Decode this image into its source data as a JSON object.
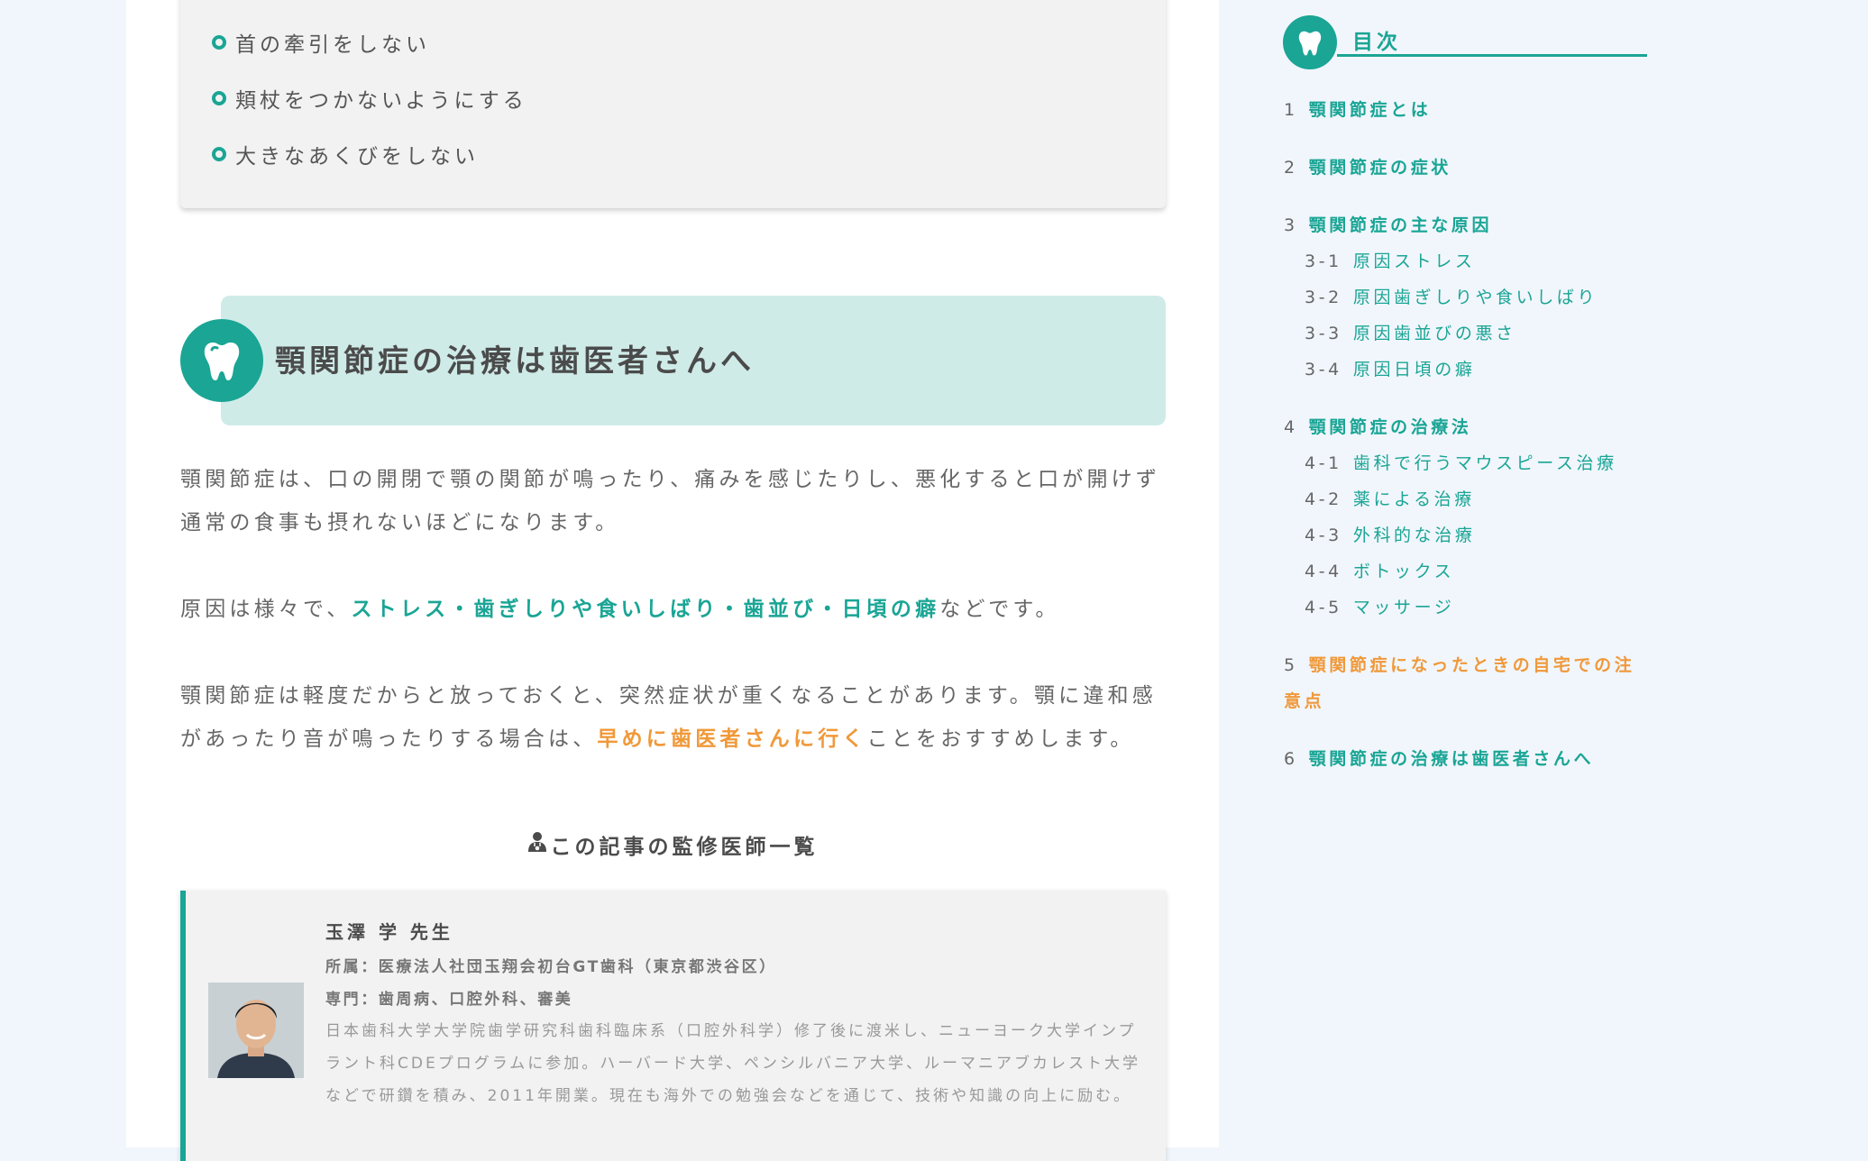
{
  "points": {
    "items": [
      "首の牽引をしない",
      "頬杖をつかないようにする",
      "大きなあくびをしない"
    ]
  },
  "section": {
    "title": "顎関節症の治療は歯医者さんへ",
    "para1": "顎関節症は、口の開閉で顎の関節が鳴ったり、痛みを感じたりし、悪化すると口が開けず通常の食事も摂れないほどになります。",
    "para2_before": "原因は様々で、",
    "para2_highlight": "ストレス・歯ぎしりや食いしばり・歯並び・日頃の癖",
    "para2_after": "などです。",
    "para3_before": "顎関節症は軽度だからと放っておくと、突然症状が重くなることがあります。顎に違和感があったり音が鳴ったりする場合は、",
    "para3_highlight": "早めに歯医者さんに行く",
    "para3_after": "ことをおすすめします。"
  },
  "supervisor": {
    "heading": "この記事の監修医師一覧",
    "name": "玉澤 学 先生",
    "affiliation": "所属：医療法人社団玉翔会初台GT歯科（東京都渋谷区）",
    "specialty": "専門：歯周病、口腔外科、審美",
    "bio": "日本歯科大学大学院歯学研究科歯科臨床系（口腔外科学）修了後に渡米し、ニューヨーク大学インプラント科CDEプログラムに参加。ハーバード大学、ペンシルバニア大学、ルーマニアブカレスト大学などで研鑽を積み、2011年開業。現在も海外での勉強会などを通じて、技術や知識の向上に励む。"
  },
  "toc": {
    "title": "目次",
    "items": [
      {
        "num": "1",
        "label": "顎関節症とは"
      },
      {
        "num": "2",
        "label": "顎関節症の症状"
      },
      {
        "num": "3",
        "label": "顎関節症の主な原因"
      },
      {
        "num": "3-1",
        "label": "原因ストレス"
      },
      {
        "num": "3-2",
        "label": "原因歯ぎしりや食いしばり"
      },
      {
        "num": "3-3",
        "label": "原因歯並びの悪さ"
      },
      {
        "num": "3-4",
        "label": "原因日頃の癖"
      },
      {
        "num": "4",
        "label": "顎関節症の治療法"
      },
      {
        "num": "4-1",
        "label": "歯科で行うマウスピース治療"
      },
      {
        "num": "4-2",
        "label": "薬による治療"
      },
      {
        "num": "4-3",
        "label": "外科的な治療"
      },
      {
        "num": "4-4",
        "label": "ボトックス"
      },
      {
        "num": "4-5",
        "label": "マッサージ"
      },
      {
        "num": "5",
        "label_line1": "顎関節症になったときの自宅での注",
        "label_line2": "意点"
      },
      {
        "num": "6",
        "label": "顎関節症の治療は歯医者さんへ"
      }
    ]
  },
  "colors": {
    "accent": "#1aa595",
    "highlight": "#f0993a",
    "heading_band": "#cfebe8"
  },
  "icons": [
    "tooth-icon",
    "doctor-icon"
  ]
}
